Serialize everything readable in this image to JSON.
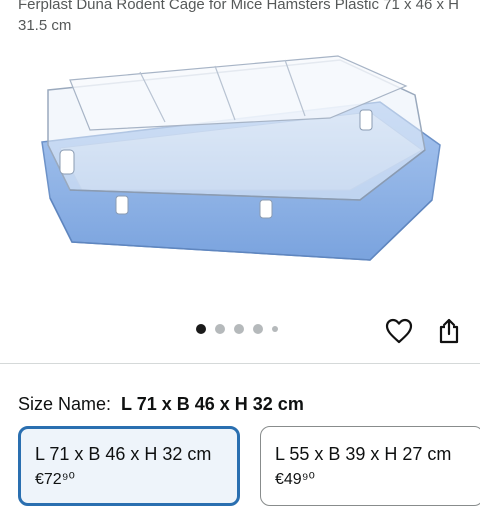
{
  "product": {
    "title": "Ferplast Duna Rodent Cage for Mice Hamsters Plastic 71 x 46 x H 31.5 cm"
  },
  "gallery": {
    "image_count": 5,
    "active_index": 0
  },
  "actions": {
    "wishlist_icon": "heart-outline-icon",
    "share_icon": "share-icon"
  },
  "size": {
    "label": "Size Name:",
    "selected": "L 71 x B 46 x H 32 cm",
    "options": [
      {
        "label": "L 71 x B 46 x H 32 cm",
        "price": "€72⁹⁰",
        "selected": true
      },
      {
        "label": "L 55 x B 39 x H 27 cm",
        "price": "€49⁹⁰",
        "selected": false
      }
    ]
  },
  "colors": {
    "accent": "#2a6fb0",
    "cage_base": "#8fb3e6"
  }
}
